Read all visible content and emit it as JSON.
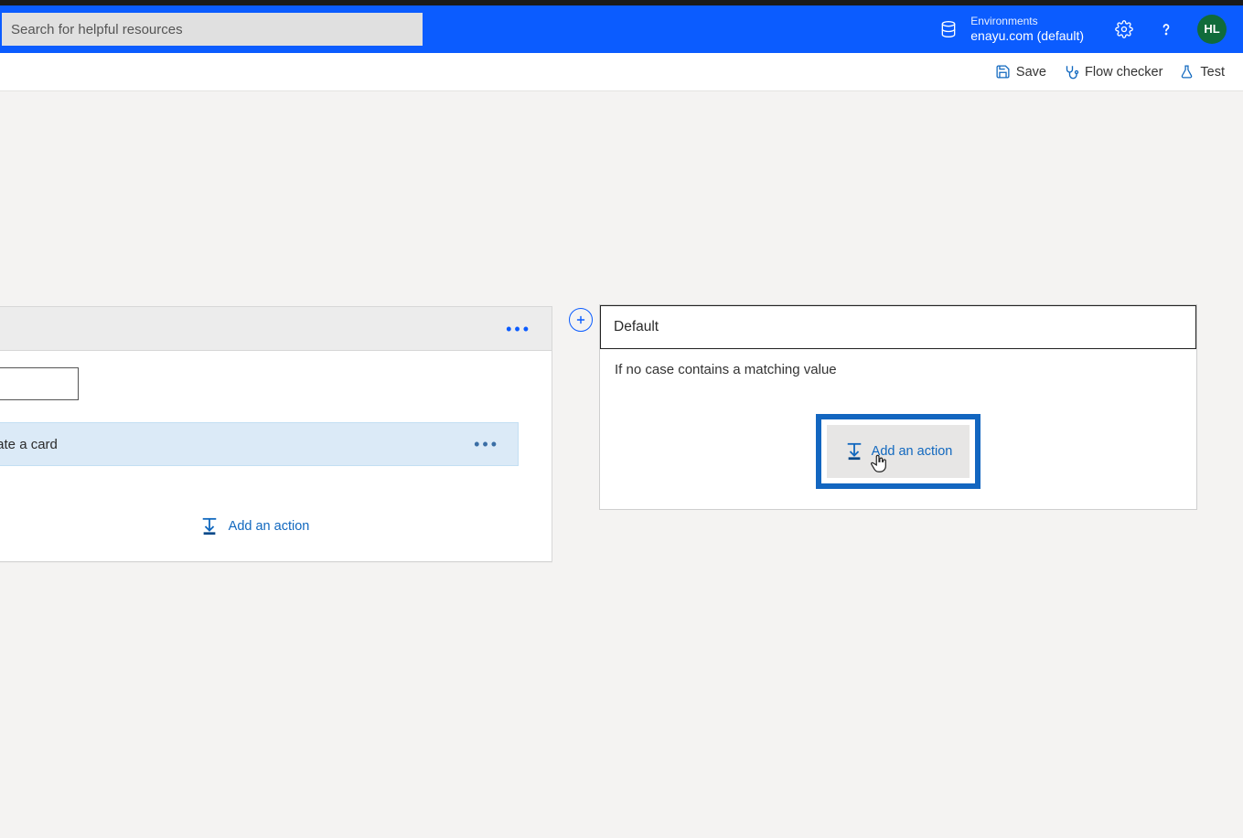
{
  "header": {
    "search_placeholder": "Search for helpful resources",
    "environments_label": "Environments",
    "environment_name": "enayu.com (default)",
    "avatar_initials": "HL"
  },
  "toolbar": {
    "save": "Save",
    "flow_checker": "Flow checker",
    "test": "Test"
  },
  "case_card": {
    "action_label": "Create a card",
    "add_action": "Add an action"
  },
  "default_card": {
    "title": "Default",
    "description": "If no case contains a matching value",
    "add_action": "Add an action"
  }
}
